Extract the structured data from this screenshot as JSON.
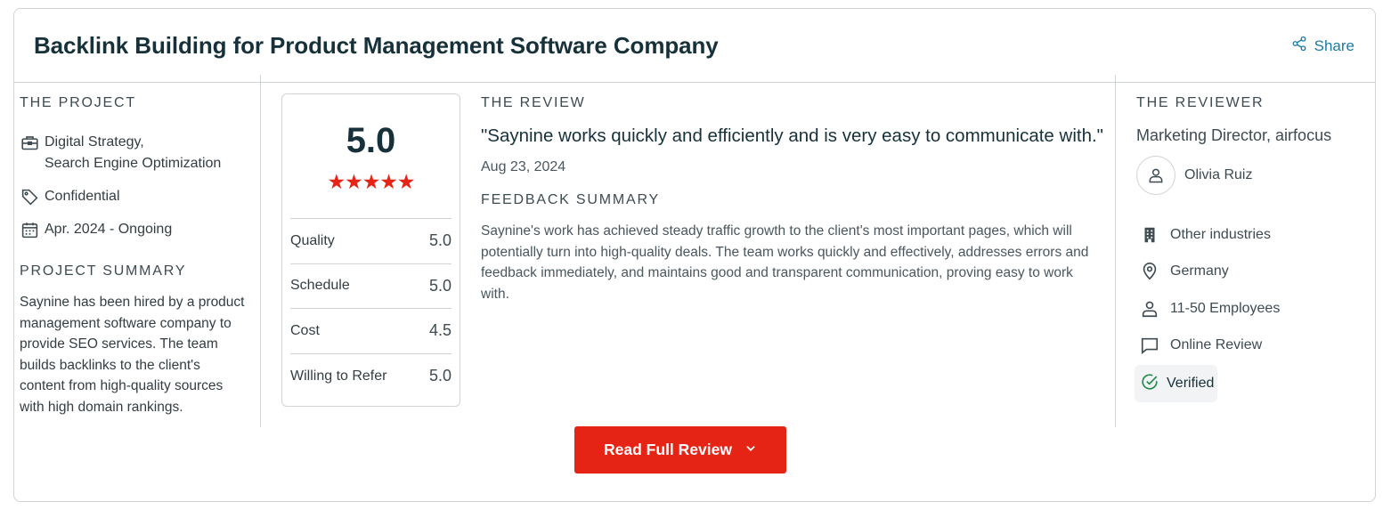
{
  "header": {
    "title": "Backlink Building for Product Management Software Company",
    "share_label": "Share"
  },
  "project": {
    "label": "THE PROJECT",
    "services": [
      "Digital Strategy,",
      "Search Engine Optimization"
    ],
    "budget": "Confidential",
    "dates": "Apr. 2024 - Ongoing",
    "summary_label": "PROJECT SUMMARY",
    "summary": "Saynine has been hired by a product management software company to provide SEO services. The team builds backlinks to the client's content from high-quality sources with high domain rankings."
  },
  "rating": {
    "overall": "5.0",
    "stars": 5,
    "rows": [
      {
        "label": "Quality",
        "value": "5.0"
      },
      {
        "label": "Schedule",
        "value": "5.0"
      },
      {
        "label": "Cost",
        "value": "4.5"
      },
      {
        "label": "Willing to Refer",
        "value": "5.0"
      }
    ]
  },
  "review": {
    "label": "THE REVIEW",
    "quote": "\"Saynine works quickly and efficiently and is very easy to communicate with.\"",
    "date": "Aug 23, 2024",
    "feedback_label": "FEEDBACK SUMMARY",
    "feedback": "Saynine's work has achieved steady traffic growth to the client's most important pages, which will potentially turn into high-quality deals. The team works quickly and effectively, addresses errors and feedback immediately, and maintains good and transparent communication, proving easy to work with."
  },
  "reviewer": {
    "label": "THE REVIEWER",
    "title": "Marketing Director, airfocus",
    "name": "Olivia Ruiz",
    "industry": "Other industries",
    "location": "Germany",
    "size": "11-50 Employees",
    "review_type": "Online Review",
    "verified": "Verified"
  },
  "actions": {
    "read_full_review": "Read Full Review"
  },
  "colors": {
    "accent_red": "#e62415",
    "link_blue": "#1a7aa8",
    "verified_green": "#1f8a4c"
  }
}
